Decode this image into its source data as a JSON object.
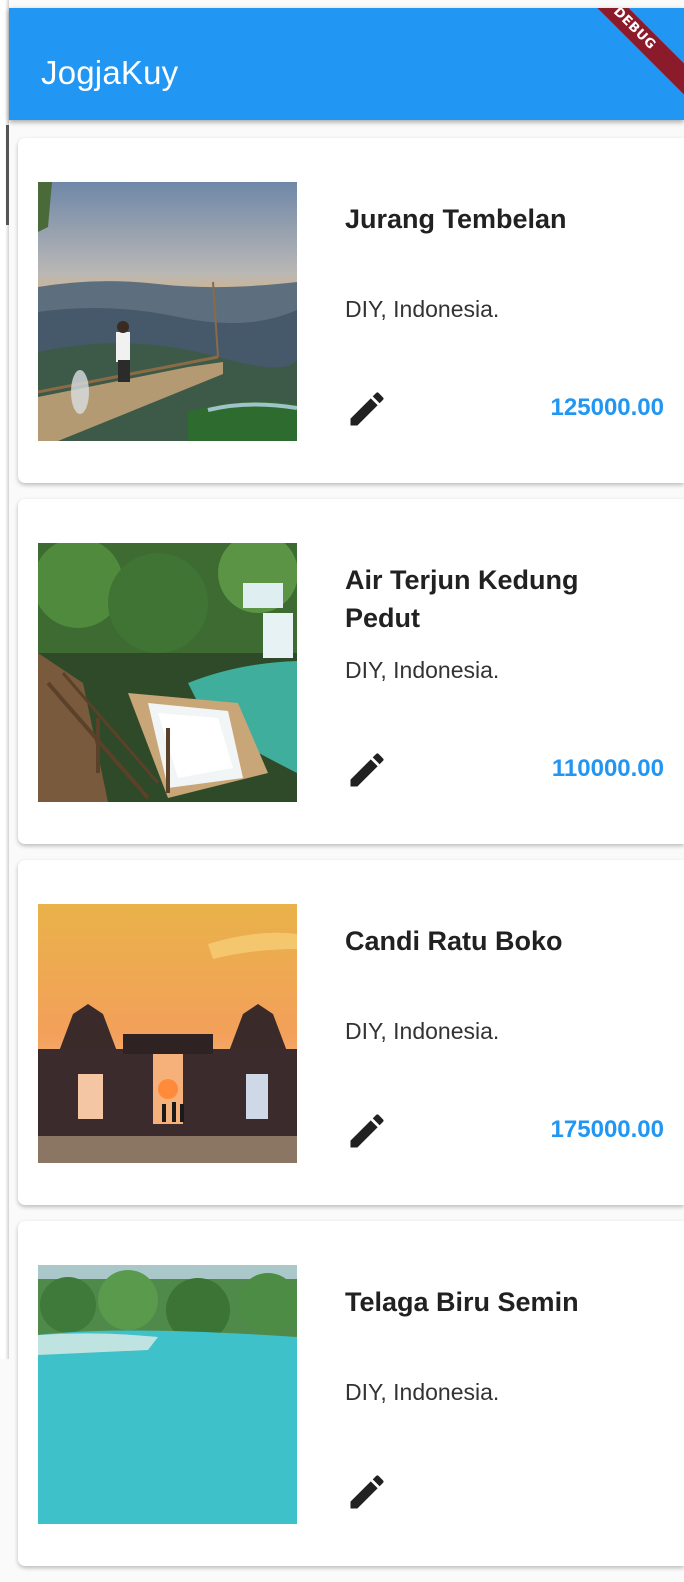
{
  "app": {
    "title": "JogjaKuy",
    "debug_label": "DEBUG"
  },
  "colors": {
    "primary": "#2196f3",
    "price": "#2196f3",
    "title_text": "#212121"
  },
  "destinations": [
    {
      "name": "Jurang Tembelan",
      "location": "DIY, Indonesia.",
      "price": "125000.00",
      "image": "mountain-viewpoint-photo"
    },
    {
      "name": "Air Terjun Kedung Pedut",
      "location": "DIY, Indonesia.",
      "price": "110000.00",
      "image": "waterfall-photo"
    },
    {
      "name": "Candi Ratu Boko",
      "location": "DIY, Indonesia.",
      "price": "175000.00",
      "image": "temple-sunset-photo"
    },
    {
      "name": "Telaga Biru Semin",
      "location": "DIY, Indonesia.",
      "price": "",
      "image": "blue-lake-photo"
    }
  ],
  "icons": {
    "edit": "pencil-icon"
  }
}
